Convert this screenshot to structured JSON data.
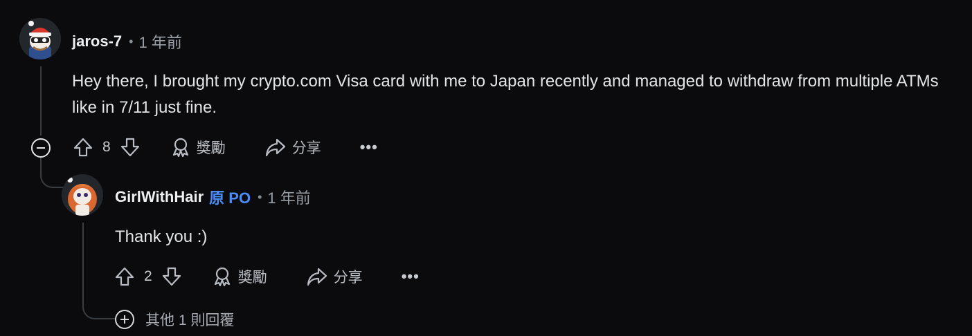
{
  "comment": {
    "author": "jaros-7",
    "separator": "•",
    "time": "1 年前",
    "body": "Hey there, I brought my crypto.com Visa card with me to Japan recently and managed to withdraw from multiple ATMs like in 7/11 just fine.",
    "score": "8",
    "award_label": "獎勵",
    "share_label": "分享",
    "more_label": "•••",
    "avatar_icon": "snoo-avatar-santa-hat-icon"
  },
  "reply": {
    "author": "GirlWithHair",
    "op_badge": "原 PO",
    "separator": "•",
    "time": "1 年前",
    "body": "Thank you :)",
    "score": "2",
    "award_label": "獎勵",
    "share_label": "分享",
    "more_label": "•••",
    "avatar_icon": "snoo-avatar-red-hair-icon"
  },
  "more_replies": {
    "label": "其他 1 則回覆"
  },
  "colors": {
    "background": "#0b0b0d",
    "text": "#e3e5e8",
    "op_badge": "#4b8cf6",
    "thread_line": "#3a3d42"
  }
}
